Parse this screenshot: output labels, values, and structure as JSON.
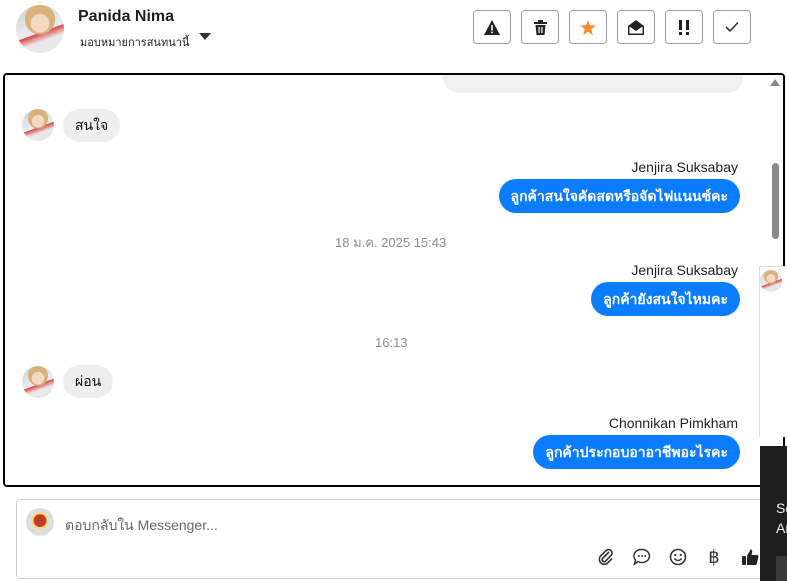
{
  "header": {
    "name": "Panida Nima",
    "assign_label": "มอบหมายการสนทนานี้",
    "toolbar": {
      "warning": "warning-icon",
      "trash": "trash-icon",
      "star": "star-icon",
      "open": "envelope-open-icon",
      "priority": "priority-icon",
      "done": "check-icon"
    },
    "colors": {
      "star": "#f28c28"
    }
  },
  "chat": {
    "messages": [
      {
        "type": "incoming",
        "text": "สนใจ"
      },
      {
        "type": "outgoing",
        "sender": "Jenjira Suksabay",
        "text": "ลูกค้าสนใจคัดสดหรือจัดไฟแนนซ์คะ"
      },
      {
        "type": "timestamp",
        "text": "18 ม.ค. 2025 15:43"
      },
      {
        "type": "outgoing",
        "sender": "Jenjira Suksabay",
        "text": "ลูกค้ายังสนใจไหมคะ"
      },
      {
        "type": "timestamp",
        "text": "16:13"
      },
      {
        "type": "incoming",
        "text": "ผ่อน"
      },
      {
        "type": "outgoing",
        "sender": "Chonnikan Pimkham",
        "text": "ลูกค้าประกอบอาอาชีพอะไรคะ"
      }
    ],
    "colors": {
      "outgoing": "#0a7cff",
      "incoming": "#eeeeee"
    }
  },
  "composer": {
    "placeholder": "ตอบกลับใน Messenger...",
    "tools": [
      "paperclip-icon",
      "speech-bubble-icon",
      "smiley-icon",
      "baht-icon",
      "thumbs-up-icon"
    ],
    "baht_symbol": "฿"
  },
  "edge": {
    "text_line1": "So",
    "text_line2": "Ar"
  }
}
